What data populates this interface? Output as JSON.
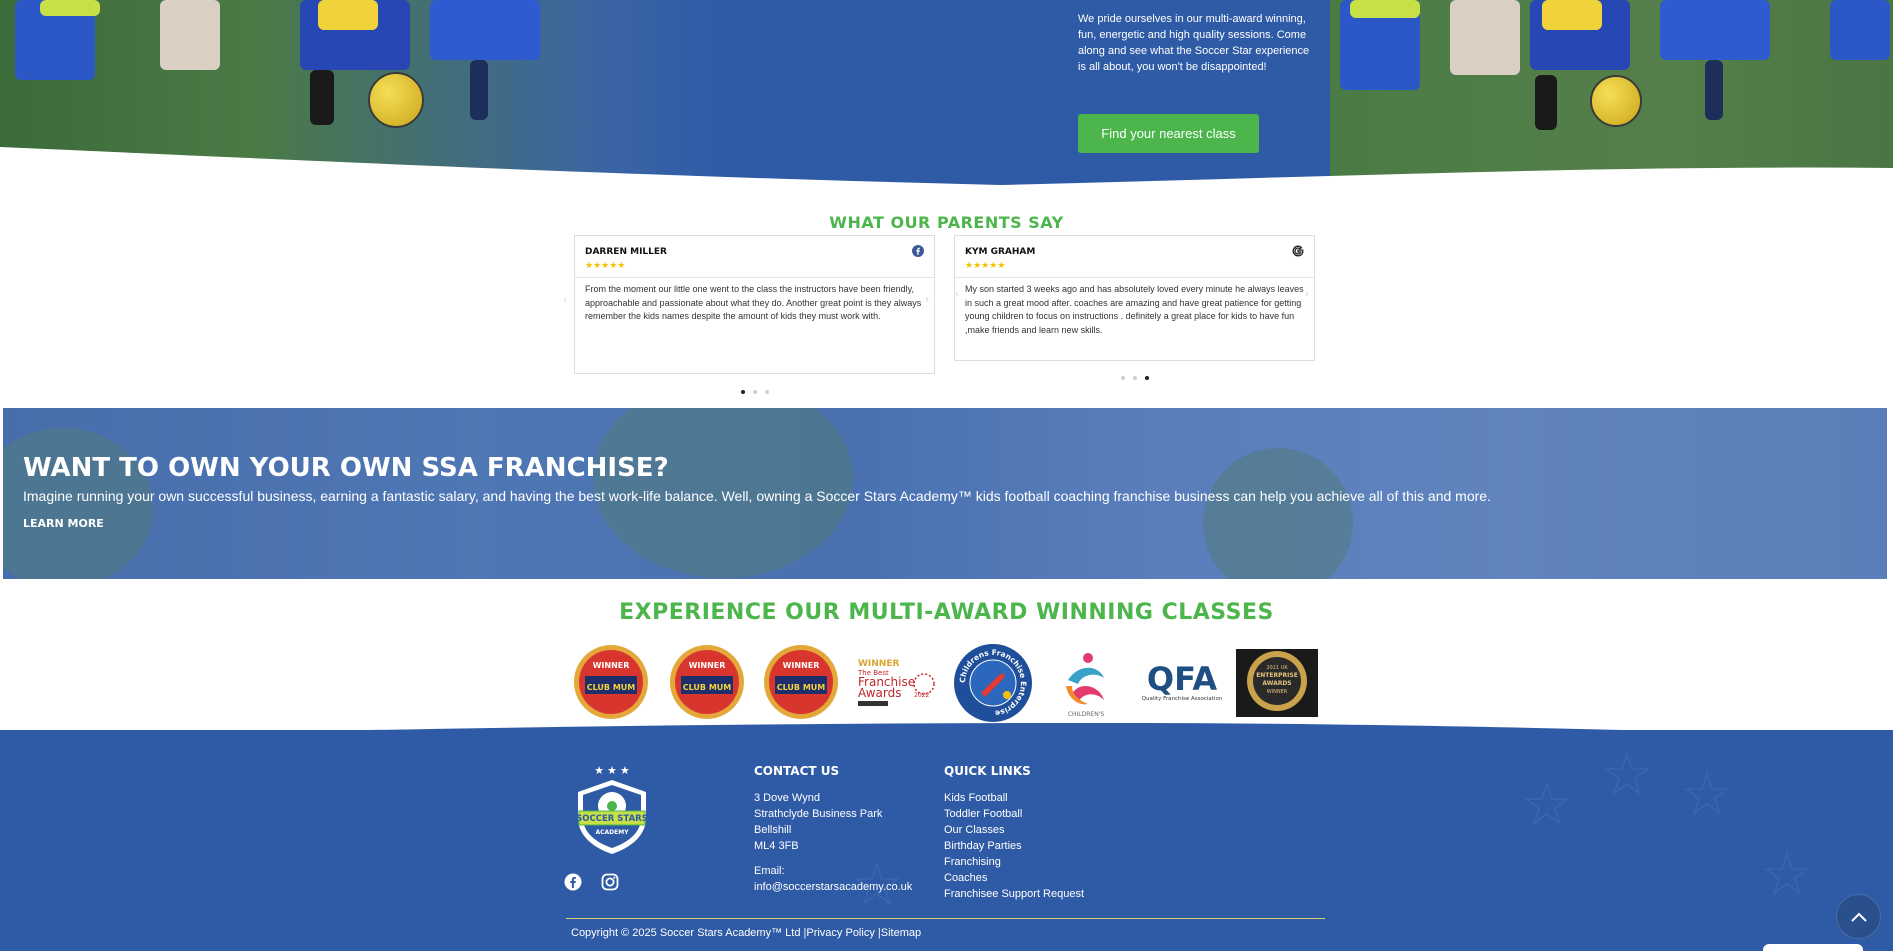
{
  "hero": {
    "text": "We pride ourselves in our multi-award winning, fun, energetic and high quality sessions. Come along and see what the Soccer Star experience is all about, you won't be disappointed!",
    "button_label": "Find your nearest class"
  },
  "reviews": {
    "title": "What our parents say",
    "cards": [
      {
        "name": "Darren Miller",
        "stars": "★★★★★",
        "source_icon": "facebook-icon",
        "text": "From the moment our little one went to the class the instructors have been friendly, approachable and passionate about what they do. Another great point is they always remember the kids names despite the amount of kids they must work with."
      },
      {
        "name": "Kym Graham",
        "stars": "★★★★★",
        "source_icon": "google-icon",
        "text": "My son started 3 weeks ago and has absolutely loved every minute he always leaves in such a great mood after. coaches are amazing and have great patience for getting young children to focus on instructions . definitely a great place for kids to have fun ,make friends and learn new skills."
      }
    ],
    "left_carousel_active_dot": 1,
    "right_carousel_active_dot": 3
  },
  "franchise": {
    "title": "Want to own your own SSA franchise?",
    "text": "Imagine running your own successful business, earning a fantastic salary, and having the best work-life balance. Well, owning a Soccer Stars Academy™ kids football coaching franchise business can help you achieve all of this and more.",
    "link_label": "Learn More"
  },
  "awards": {
    "title": "Experience our multi-award winning classes",
    "badges": [
      {
        "top": "WINNER",
        "bottom": "CLUB MUM"
      },
      {
        "top": "WINNER",
        "bottom": "CLUB MUM"
      },
      {
        "top": "WINNER",
        "bottom": "CLUB MUM"
      },
      {
        "top": "WINNER",
        "line1": "The Best",
        "line2": "Franchise",
        "line3": "Awards",
        "year": "2022"
      },
      {
        "ring": "Childrens Franchise Enterprise"
      },
      {
        "caption": "CHILDREN'S"
      },
      {
        "big": "QFA",
        "caption": "Quality Franchise Association"
      },
      {
        "line1": "2021 UK",
        "line2": "ENTERPRISE",
        "line3": "AWARDS",
        "line4": "WINNER"
      }
    ]
  },
  "footer": {
    "logo": {
      "line1": "SOCCER STARS",
      "line2": "ACADEMY"
    },
    "contact": {
      "heading": "Contact Us",
      "address": [
        "3 Dove Wynd",
        "Strathclyde Business Park",
        "Bellshill",
        "ML4 3FB"
      ],
      "email_label": "Email:",
      "email": "info@soccerstarsacademy.co.uk"
    },
    "quick_links": {
      "heading": "Quick Links",
      "items": [
        "Kids Football",
        "Toddler Football",
        "Our Classes",
        "Birthday Parties",
        "Franchising",
        "Coaches",
        "Franchisee Support Request"
      ]
    },
    "copyright": "Copyright © 2025 Soccer Stars Academy™ Ltd",
    "separator": "|",
    "privacy_label": "Privacy Policy",
    "sitemap_label": "Sitemap"
  },
  "colors": {
    "brand_blue": "#2f5ba6",
    "brand_green": "#4cb64c",
    "star_yellow": "#f2c200"
  }
}
